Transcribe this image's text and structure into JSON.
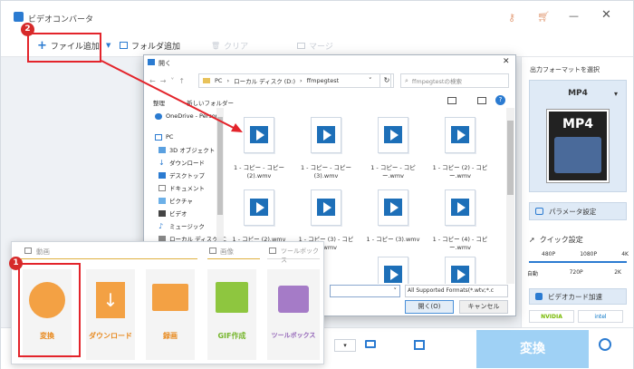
{
  "app": {
    "title": "ビデオコンバータ"
  },
  "toolbar": {
    "add_file": "ファイル追加",
    "add_folder": "フォルダ追加",
    "clear": "クリア",
    "merge": "マージ"
  },
  "dialog": {
    "title": "開く",
    "breadcrumb": [
      "PC",
      "ローカル ディスク (D:)",
      "ffmpegtest"
    ],
    "search_placeholder": "ffmpegtestの検索",
    "organize": "整理",
    "new_folder": "新しいフォルダー",
    "nav": [
      "OneDrive - Person",
      "PC",
      "3D オブジェクト",
      "ダウンロード",
      "デスクトップ",
      "ドキュメント",
      "ピクチャ",
      "ビデオ",
      "ミュージック",
      "ローカル ディスク (C"
    ],
    "files": [
      "1 - コピー - コピー (2).wmv",
      "1 - コピー - コピー (3).wmv",
      "1 - コピー - コピー.wmv",
      "1 - コピー (2) - コピー.wmv",
      "1 - コピー (2).wmv",
      "1 - コピー (3) - コピー.wmv",
      "1 - コピー (3).wmv",
      "1 - コピー (4) - コピー.wmv"
    ],
    "filter": "All Supported Formats(*.wtv;*.c",
    "open_btn": "開く(O)",
    "cancel_btn": "キャンセル"
  },
  "launcher": {
    "section_video": "動画",
    "section_image": "画像",
    "section_toolbox": "ツールボックス",
    "tiles": [
      "変換",
      "ダウンロード",
      "録画",
      "GIF作成",
      "ツールボックス"
    ]
  },
  "panel": {
    "output_label": "出力フォーマットを選択",
    "format": "MP4",
    "format_logo": "MP4",
    "params": "パラメータ設定",
    "quick": "クイック設定",
    "q_top": [
      "480P",
      "1080P",
      "4K"
    ],
    "q_bottom": [
      "自動",
      "720P",
      "2K"
    ],
    "gpu": "ビデオカード加速",
    "nvidia": "NVIDIA",
    "intel": "intel"
  },
  "convert": "変換",
  "badges": [
    "2",
    "1"
  ],
  "colors": {
    "accent": "#2b7bd1",
    "convert_btn": "#9fd1f5",
    "highlight": "#e3242b"
  }
}
